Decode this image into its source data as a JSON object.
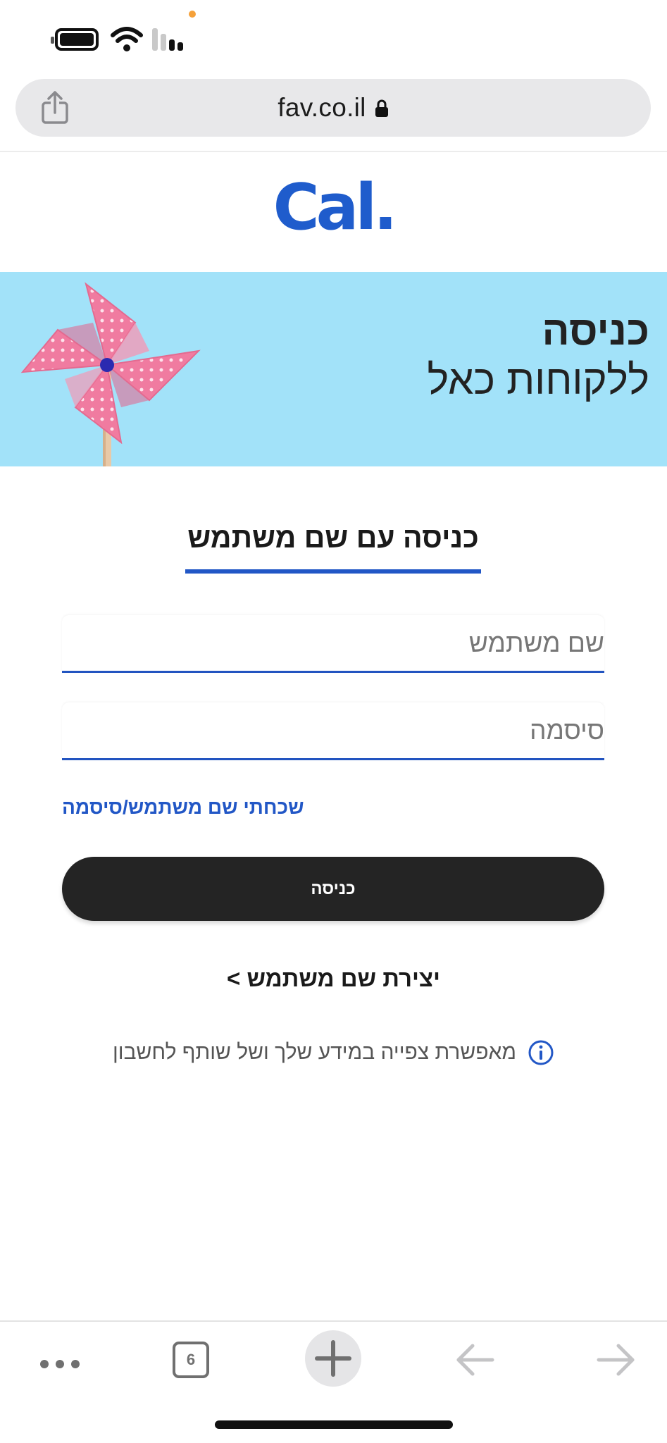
{
  "browser": {
    "url": "fav.co.il",
    "open_tabs_count": "6"
  },
  "site": {
    "logo_text": "Cal."
  },
  "banner": {
    "title": "כניסה",
    "subtitle": "ללקוחות כאל"
  },
  "login": {
    "tab_label": "כניסה עם שם משתמש",
    "username_placeholder": "שם משתמש",
    "password_placeholder": "סיסמה",
    "forgot_link": "שכחתי שם משתמש/סיסמה",
    "submit_label": "כניסה",
    "create_user_link": "יצירת שם משתמש >",
    "info_text": "מאפשרת צפייה במידע שלך ושל שותף לחשבון"
  },
  "colors": {
    "brand_blue": "#1f5ccc",
    "banner_bg": "#a2e2f9",
    "button_dark": "#242424"
  },
  "icons": [
    "battery-icon",
    "wifi-icon",
    "signal-icon",
    "share-icon",
    "lock-icon",
    "pinwheel-image",
    "info-icon",
    "more-icon",
    "tabs-icon",
    "new-tab-icon",
    "back-arrow-icon",
    "forward-arrow-icon"
  ]
}
